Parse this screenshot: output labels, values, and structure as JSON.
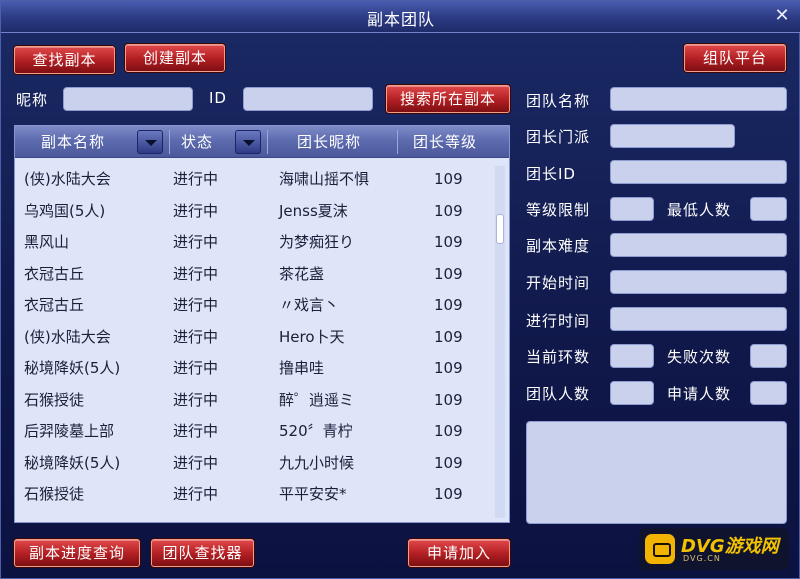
{
  "window": {
    "title": "副本团队",
    "close_glyph": "✕"
  },
  "top_buttons": {
    "find_dungeon": "查找副本",
    "create_dungeon": "创建副本",
    "team_platform": "组队平台"
  },
  "search": {
    "nickname_label": "昵称",
    "nickname_value": "",
    "id_label": "ID",
    "id_value": "",
    "search_button": "搜索所在副本"
  },
  "list": {
    "headers": {
      "name": "副本名称",
      "status": "状态",
      "leader_nick": "团长昵称",
      "leader_level": "团长等级"
    },
    "rows": [
      {
        "name": "(侠)水陆大会",
        "status": "进行中",
        "leader": "海啸山摇不惧",
        "level": "109"
      },
      {
        "name": "乌鸡国(5人)",
        "status": "进行中",
        "leader": "Jenss夏沫",
        "level": "109"
      },
      {
        "name": "黑风山",
        "status": "进行中",
        "leader": "为梦痴狂り",
        "level": "109"
      },
      {
        "name": "衣冠古丘",
        "status": "进行中",
        "leader": "茶花盏",
        "level": "109"
      },
      {
        "name": "衣冠古丘",
        "status": "进行中",
        "leader": "〃戏言丶",
        "level": "109"
      },
      {
        "name": "(侠)水陆大会",
        "status": "进行中",
        "leader": "Hero卜天",
        "level": "109"
      },
      {
        "name": "秘境降妖(5人)",
        "status": "进行中",
        "leader": "撸串哇",
        "level": "109"
      },
      {
        "name": "石猴授徒",
        "status": "进行中",
        "leader": "醉゜逍遥ミ",
        "level": "109"
      },
      {
        "name": "后羿陵墓上部",
        "status": "进行中",
        "leader": "520〞青柠",
        "level": "109"
      },
      {
        "name": "秘境降妖(5人)",
        "status": "进行中",
        "leader": "九九小时候",
        "level": "109"
      },
      {
        "name": "石猴授徒",
        "status": "进行中",
        "leader": "平平安安*",
        "level": "109"
      }
    ]
  },
  "details": {
    "team_name_label": "团队名称",
    "leader_sect_label": "团长门派",
    "leader_id_label": "团长ID",
    "level_limit_label": "等级限制",
    "min_people_label": "最低人数",
    "difficulty_label": "副本难度",
    "start_time_label": "开始时间",
    "elapsed_time_label": "进行时间",
    "current_round_label": "当前环数",
    "fail_count_label": "失败次数",
    "team_size_label": "团队人数",
    "applicants_label": "申请人数"
  },
  "bottom_buttons": {
    "progress_query": "副本进度查询",
    "team_finder": "团队查找器",
    "apply_join": "申请加入"
  },
  "watermark": {
    "brand": "DVG游戏网",
    "domain": "DVG.CN"
  },
  "colors": {
    "button_red": "#b01e22",
    "header_blue": "#5b69ad",
    "field_bg": "#c9d1ec",
    "window_bg": "#1b2a66"
  }
}
